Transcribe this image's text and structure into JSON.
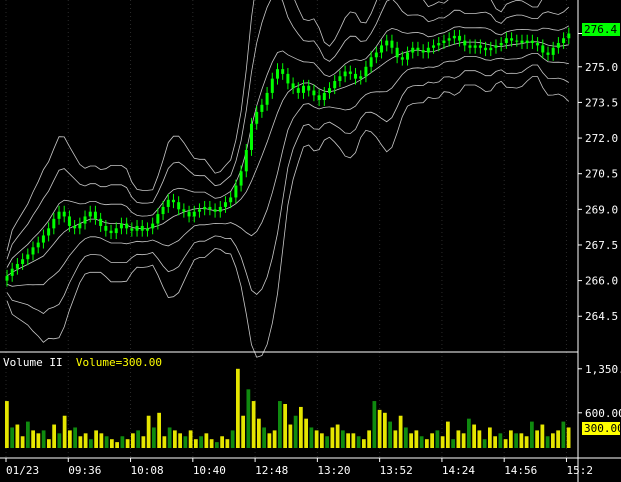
{
  "chart_data": [
    {
      "type": "candlestick",
      "title": "",
      "y_ticks": [
        "276.4",
        "275.0",
        "273.5",
        "272.0",
        "270.5",
        "269.0",
        "267.5",
        "266.0",
        "264.5"
      ],
      "ylim": [
        263.5,
        277.6
      ],
      "x_ticks": [
        "01/23",
        "09:36",
        "10:08",
        "10:40",
        "12:48",
        "13:20",
        "13:52",
        "14:24",
        "14:56",
        "15:2"
      ],
      "last_price": "276.4",
      "price_color": "#00ff00",
      "envelope_color": "#c8c8c8",
      "close_series": [
        266.2,
        266.5,
        266.7,
        266.9,
        267.1,
        267.4,
        267.6,
        267.9,
        268.2,
        268.6,
        268.9,
        268.7,
        268.3,
        268.2,
        268.4,
        268.7,
        268.9,
        268.6,
        268.3,
        268.1,
        268.0,
        268.2,
        268.4,
        268.2,
        268.1,
        268.3,
        268.1,
        268.2,
        268.4,
        268.8,
        269.1,
        269.4,
        269.3,
        269.0,
        268.9,
        268.7,
        268.9,
        269.0,
        269.1,
        269.0,
        268.9,
        269.1,
        269.3,
        269.5,
        270.0,
        270.6,
        271.5,
        272.6,
        273.1,
        273.4,
        273.9,
        274.5,
        274.9,
        274.7,
        274.3,
        274.1,
        273.9,
        274.2,
        274.0,
        273.8,
        273.6,
        273.9,
        274.1,
        274.4,
        274.6,
        274.8,
        274.7,
        274.5,
        274.6,
        275.0,
        275.4,
        275.6,
        275.9,
        276.1,
        275.8,
        275.4,
        275.3,
        275.6,
        275.8,
        275.7,
        275.6,
        275.8,
        275.9,
        276.0,
        276.1,
        276.2,
        276.3,
        276.1,
        275.9,
        275.8,
        275.9,
        275.8,
        275.7,
        275.8,
        275.9,
        276.0,
        276.2,
        276.1,
        276.1,
        276.0,
        276.1,
        276.0,
        275.9,
        275.6,
        275.5,
        275.8,
        276.0,
        276.2,
        276.4
      ]
    },
    {
      "type": "bar",
      "title": "Volume II",
      "value_label": "Volume=300.00",
      "y_ticks": [
        "1,350.",
        "600.00"
      ],
      "ylim": [
        0,
        1500
      ],
      "last_value": "300.00",
      "value_color": "#ffff00",
      "values": [
        800,
        350,
        400,
        200,
        450,
        300,
        250,
        300,
        150,
        400,
        250,
        550,
        300,
        350,
        200,
        250,
        150,
        300,
        250,
        200,
        150,
        100,
        200,
        150,
        250,
        300,
        200,
        550,
        350,
        600,
        200,
        350,
        300,
        250,
        200,
        300,
        150,
        200,
        250,
        150,
        100,
        200,
        150,
        300,
        1350,
        550,
        1000,
        800,
        500,
        350,
        250,
        300,
        800,
        750,
        400,
        550,
        700,
        500,
        350,
        300,
        250,
        200,
        350,
        400,
        300,
        250,
        250,
        200,
        150,
        300,
        800,
        650,
        600,
        450,
        300,
        550,
        350,
        250,
        300,
        200,
        150,
        250,
        300,
        200,
        450,
        150,
        300,
        250,
        500,
        400,
        300,
        150,
        350,
        200,
        250,
        150,
        300,
        250,
        250,
        200,
        450,
        300,
        400,
        200,
        250,
        300,
        450,
        350
      ]
    }
  ]
}
